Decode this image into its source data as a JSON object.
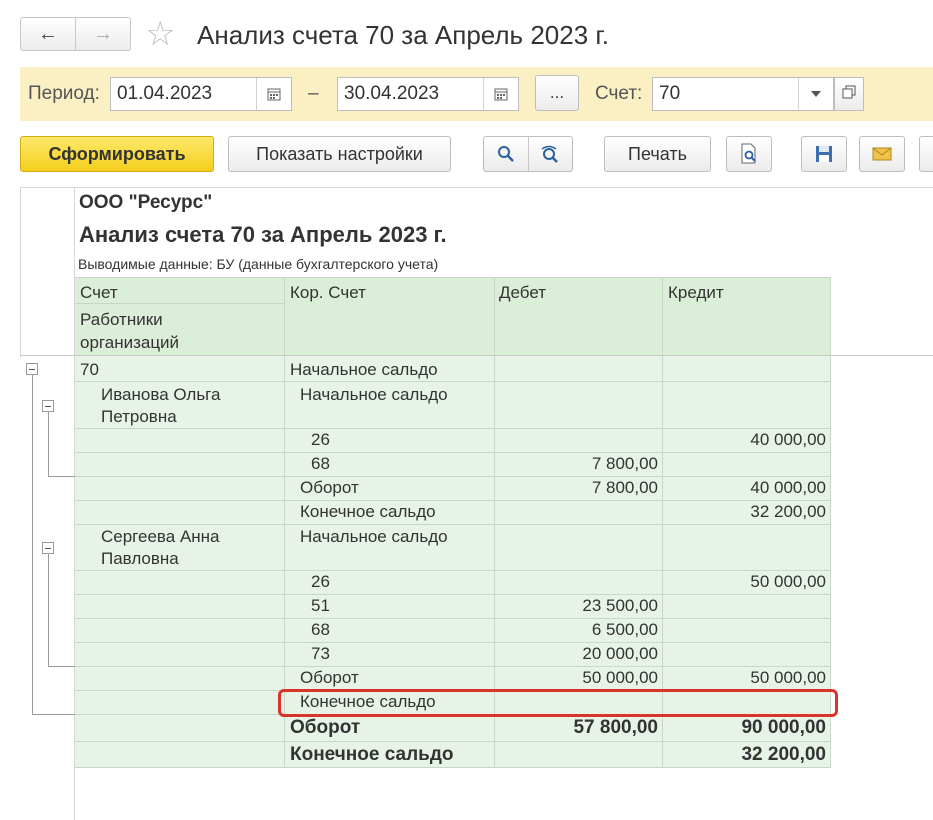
{
  "window": {
    "title": "Анализ счета 70 за Апрель 2023 г."
  },
  "nav": {
    "back_icon": "arrow-left",
    "forward_icon": "arrow-right",
    "favorite_icon": "star"
  },
  "period": {
    "label": "Период:",
    "from": "01.04.2023",
    "dash": "–",
    "to": "30.04.2023",
    "ellipsis": "...",
    "account_label": "Счет:",
    "account_value": "70"
  },
  "toolbar": {
    "generate": "Сформировать",
    "settings": "Показать настройки",
    "print": "Печать"
  },
  "report": {
    "org": "ООО \"Ресурс\"",
    "title": "Анализ счета 70 за Апрель 2023 г.",
    "output": "Выводимые данные: БУ (данные бухгалтерского учета)",
    "headers": {
      "account": "Счет",
      "employees_line1": "Работники",
      "employees_line2": "организаций",
      "cor_account": "Кор. Счет",
      "debit": "Дебет",
      "credit": "Кредит"
    },
    "rows": [
      {
        "account": "70",
        "cor": "Начальное сальдо",
        "debit": "",
        "credit": ""
      },
      {
        "account": "Иванова Ольга",
        "account2": "Петровна",
        "cor": "Начальное сальдо",
        "debit": "",
        "credit": ""
      },
      {
        "cor": "26",
        "debit": "",
        "credit": "40 000,00"
      },
      {
        "cor": "68",
        "debit": "7 800,00",
        "credit": ""
      },
      {
        "cor": "Оборот",
        "debit": "7 800,00",
        "credit": "40 000,00"
      },
      {
        "cor": "Конечное сальдо",
        "debit": "",
        "credit": "32 200,00"
      },
      {
        "account": "Сергеева Анна",
        "account2": "Павловна",
        "cor": "Начальное сальдо",
        "debit": "",
        "credit": ""
      },
      {
        "cor": "26",
        "debit": "",
        "credit": "50 000,00"
      },
      {
        "cor": "51",
        "debit": "23 500,00",
        "credit": ""
      },
      {
        "cor": "68",
        "debit": "6 500,00",
        "credit": ""
      },
      {
        "cor": "73",
        "debit": "20 000,00",
        "credit": ""
      },
      {
        "cor": "Оборот",
        "debit": "50 000,00",
        "credit": "50 000,00"
      },
      {
        "cor": "Конечное сальдо",
        "debit": "",
        "credit": ""
      },
      {
        "cor": "Оборот",
        "debit": "57 800,00",
        "credit": "90 000,00"
      },
      {
        "cor": "Конечное сальдо",
        "debit": "",
        "credit": "32 200,00"
      }
    ]
  },
  "colors": {
    "period_bar": "#fbf0c3",
    "table_bg": "#e8f3e7",
    "table_header_bg": "#dbeed8",
    "highlight": "#d9342b",
    "primary_button": "#f5cf1d"
  }
}
